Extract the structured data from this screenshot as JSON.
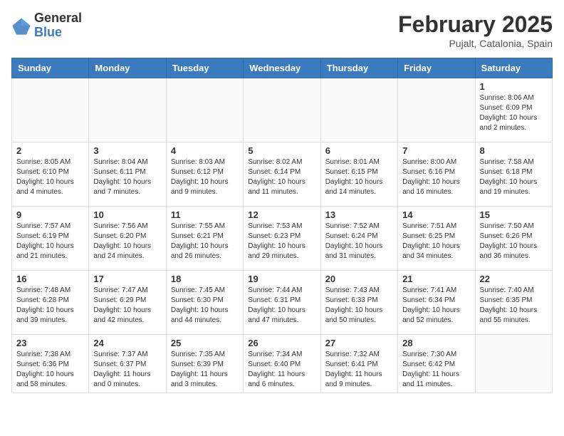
{
  "logo": {
    "general": "General",
    "blue": "Blue"
  },
  "title": {
    "month_year": "February 2025",
    "location": "Pujalt, Catalonia, Spain"
  },
  "days_of_week": [
    "Sunday",
    "Monday",
    "Tuesday",
    "Wednesday",
    "Thursday",
    "Friday",
    "Saturday"
  ],
  "weeks": [
    [
      {
        "day": "",
        "info": ""
      },
      {
        "day": "",
        "info": ""
      },
      {
        "day": "",
        "info": ""
      },
      {
        "day": "",
        "info": ""
      },
      {
        "day": "",
        "info": ""
      },
      {
        "day": "",
        "info": ""
      },
      {
        "day": "1",
        "info": "Sunrise: 8:06 AM\nSunset: 6:09 PM\nDaylight: 10 hours and 2 minutes."
      }
    ],
    [
      {
        "day": "2",
        "info": "Sunrise: 8:05 AM\nSunset: 6:10 PM\nDaylight: 10 hours and 4 minutes."
      },
      {
        "day": "3",
        "info": "Sunrise: 8:04 AM\nSunset: 6:11 PM\nDaylight: 10 hours and 7 minutes."
      },
      {
        "day": "4",
        "info": "Sunrise: 8:03 AM\nSunset: 6:12 PM\nDaylight: 10 hours and 9 minutes."
      },
      {
        "day": "5",
        "info": "Sunrise: 8:02 AM\nSunset: 6:14 PM\nDaylight: 10 hours and 11 minutes."
      },
      {
        "day": "6",
        "info": "Sunrise: 8:01 AM\nSunset: 6:15 PM\nDaylight: 10 hours and 14 minutes."
      },
      {
        "day": "7",
        "info": "Sunrise: 8:00 AM\nSunset: 6:16 PM\nDaylight: 10 hours and 16 minutes."
      },
      {
        "day": "8",
        "info": "Sunrise: 7:58 AM\nSunset: 6:18 PM\nDaylight: 10 hours and 19 minutes."
      }
    ],
    [
      {
        "day": "9",
        "info": "Sunrise: 7:57 AM\nSunset: 6:19 PM\nDaylight: 10 hours and 21 minutes."
      },
      {
        "day": "10",
        "info": "Sunrise: 7:56 AM\nSunset: 6:20 PM\nDaylight: 10 hours and 24 minutes."
      },
      {
        "day": "11",
        "info": "Sunrise: 7:55 AM\nSunset: 6:21 PM\nDaylight: 10 hours and 26 minutes."
      },
      {
        "day": "12",
        "info": "Sunrise: 7:53 AM\nSunset: 6:23 PM\nDaylight: 10 hours and 29 minutes."
      },
      {
        "day": "13",
        "info": "Sunrise: 7:52 AM\nSunset: 6:24 PM\nDaylight: 10 hours and 31 minutes."
      },
      {
        "day": "14",
        "info": "Sunrise: 7:51 AM\nSunset: 6:25 PM\nDaylight: 10 hours and 34 minutes."
      },
      {
        "day": "15",
        "info": "Sunrise: 7:50 AM\nSunset: 6:26 PM\nDaylight: 10 hours and 36 minutes."
      }
    ],
    [
      {
        "day": "16",
        "info": "Sunrise: 7:48 AM\nSunset: 6:28 PM\nDaylight: 10 hours and 39 minutes."
      },
      {
        "day": "17",
        "info": "Sunrise: 7:47 AM\nSunset: 6:29 PM\nDaylight: 10 hours and 42 minutes."
      },
      {
        "day": "18",
        "info": "Sunrise: 7:45 AM\nSunset: 6:30 PM\nDaylight: 10 hours and 44 minutes."
      },
      {
        "day": "19",
        "info": "Sunrise: 7:44 AM\nSunset: 6:31 PM\nDaylight: 10 hours and 47 minutes."
      },
      {
        "day": "20",
        "info": "Sunrise: 7:43 AM\nSunset: 6:33 PM\nDaylight: 10 hours and 50 minutes."
      },
      {
        "day": "21",
        "info": "Sunrise: 7:41 AM\nSunset: 6:34 PM\nDaylight: 10 hours and 52 minutes."
      },
      {
        "day": "22",
        "info": "Sunrise: 7:40 AM\nSunset: 6:35 PM\nDaylight: 10 hours and 55 minutes."
      }
    ],
    [
      {
        "day": "23",
        "info": "Sunrise: 7:38 AM\nSunset: 6:36 PM\nDaylight: 10 hours and 58 minutes."
      },
      {
        "day": "24",
        "info": "Sunrise: 7:37 AM\nSunset: 6:37 PM\nDaylight: 11 hours and 0 minutes."
      },
      {
        "day": "25",
        "info": "Sunrise: 7:35 AM\nSunset: 6:39 PM\nDaylight: 11 hours and 3 minutes."
      },
      {
        "day": "26",
        "info": "Sunrise: 7:34 AM\nSunset: 6:40 PM\nDaylight: 11 hours and 6 minutes."
      },
      {
        "day": "27",
        "info": "Sunrise: 7:32 AM\nSunset: 6:41 PM\nDaylight: 11 hours and 9 minutes."
      },
      {
        "day": "28",
        "info": "Sunrise: 7:30 AM\nSunset: 6:42 PM\nDaylight: 11 hours and 11 minutes."
      },
      {
        "day": "",
        "info": ""
      }
    ]
  ]
}
